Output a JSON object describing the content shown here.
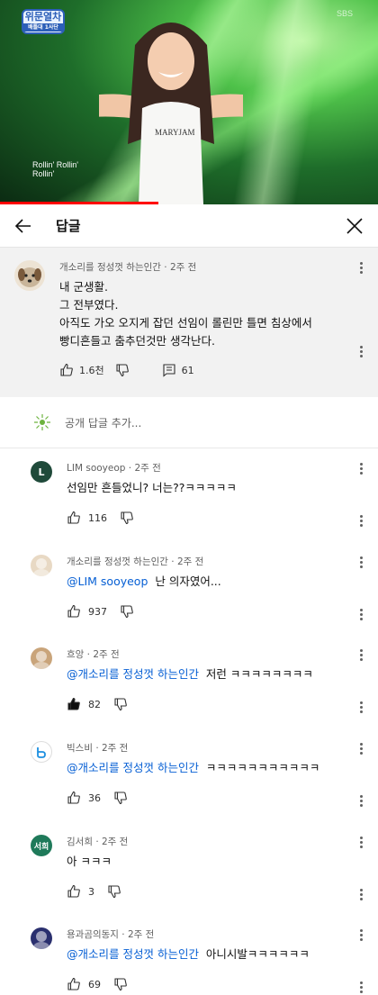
{
  "video": {
    "logo_text": "위문열차",
    "logo_sub": "배틀대 1사단",
    "caption_lines": [
      "Rollin' Rollin'",
      "Rollin'"
    ],
    "watermark": "SBS",
    "shirt_text": "MARYJAM",
    "progress_fraction": 0.42,
    "accent_color": "#ff0000"
  },
  "header": {
    "title": "답글",
    "back_icon": "arrow-left-icon",
    "close_icon": "close-icon"
  },
  "parent_comment": {
    "author": "개소리를 정성껏 하는인간",
    "time": "2주 전",
    "lines": [
      "내 군생활.",
      "그 전부였다.",
      "아직도 가오 오지게 잡던 선임이 롤린만 틀면 침상에서",
      "빵디흔들고 춤추던것만 생각난다."
    ],
    "likes": "1.6천",
    "replies": "61"
  },
  "add_reply": {
    "placeholder": "공개 답글 추가..."
  },
  "replies": [
    {
      "author": "LIM sooyeop",
      "time": "2주 전",
      "avatar_letter": "L",
      "avatar_color": "#1f4a3a",
      "mention": "",
      "text": "선임만 흔들었니? 너는??ㅋㅋㅋㅋㅋ",
      "likes": "116",
      "liked": false
    },
    {
      "author": "개소리를 정성껏 하는인간",
      "time": "2주 전",
      "avatar_letter": "",
      "avatar_color": "#e8d9c4",
      "mention": "@LIM sooyeop",
      "text": "난 의자였어...",
      "likes": "937",
      "liked": false
    },
    {
      "author": "흐앙",
      "time": "2주 전",
      "avatar_letter": "",
      "avatar_color": "#c9a47a",
      "mention": "@개소리를 정성껏 하는인간",
      "text": "저런 ㅋㅋㅋㅋㅋㅋㅋㅋ",
      "likes": "82",
      "liked": true
    },
    {
      "author": "빅스비",
      "time": "2주 전",
      "avatar_letter": "b",
      "avatar_color": "#ffffff",
      "mention": "@개소리를 정성껏 하는인간",
      "text": "ㅋㅋㅋㅋㅋㅋㅋㅋㅋㅋㅋ",
      "likes": "36",
      "liked": false
    },
    {
      "author": "김서희",
      "time": "2주 전",
      "avatar_letter": "서희",
      "avatar_color": "#1f7a5a",
      "mention": "",
      "text": "아 ㅋㅋㅋ",
      "likes": "3",
      "liked": false
    },
    {
      "author": "용과곰의동지",
      "time": "2주 전",
      "avatar_letter": "",
      "avatar_color": "#2a2f6e",
      "mention": "@개소리를 정성껏 하는인간",
      "text": "아니시발ㅋㅋㅋㅋㅋㅋ",
      "likes": "69",
      "liked": false
    }
  ]
}
